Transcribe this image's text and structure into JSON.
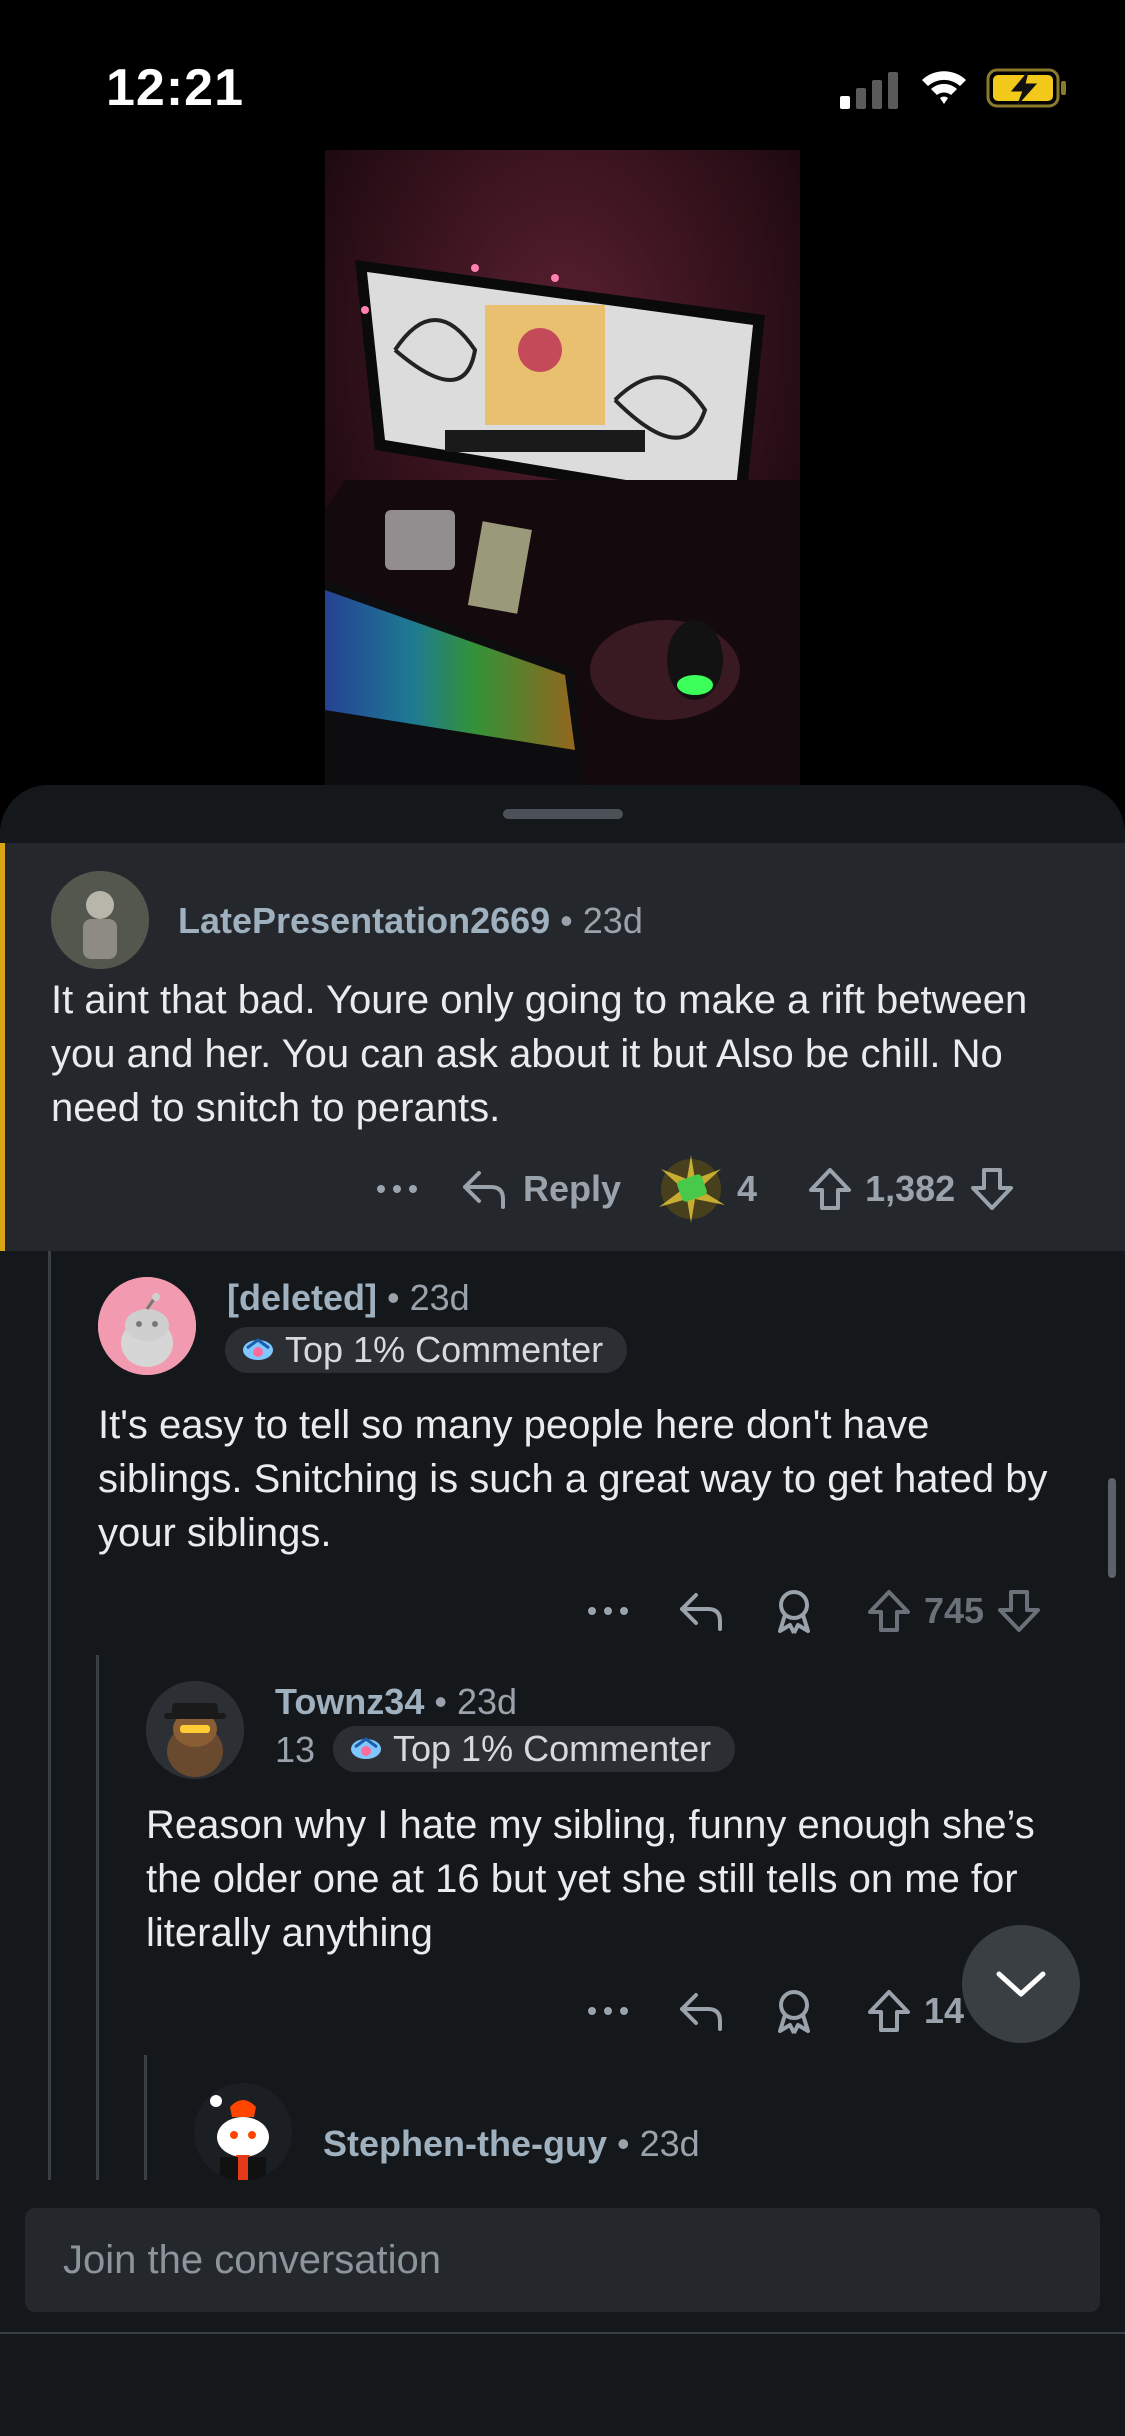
{
  "status_bar": {
    "time": "12:21",
    "icons": [
      "cellular-signal-icon",
      "wifi-icon",
      "battery-charging-icon"
    ]
  },
  "media": {
    "icon": "photo-of-monitor-and-keyboard"
  },
  "comments": [
    {
      "username": "LatePresentation2669",
      "age": "23d",
      "body": "It aint that bad. Youre only going to make a rift between you and her. You can ask about it but Also be chill. No need to snitch to perants.",
      "reply_label": "Reply",
      "award_count": "4",
      "score": "1,382"
    },
    {
      "username": "[deleted]",
      "age": "23d",
      "flair": "Top 1% Commenter",
      "body": "It's easy to tell so many people here don't have siblings. Snitching is such a great way to get hated by your siblings.",
      "score": "745"
    },
    {
      "username": "Townz34",
      "age": "23d",
      "karma_prefix": "13",
      "flair": "Top 1% Commenter",
      "body": "Reason why I hate my sibling, funny enough she’s the older one at 16 but yet she still tells on me for literally anything",
      "score": "14"
    },
    {
      "username": "Stephen-the-guy",
      "age": "23d"
    }
  ],
  "composer": {
    "placeholder": "Join the conversation"
  },
  "colors": {
    "highlight_border": "#d9a514",
    "sheet_bg": "#15181b",
    "highlight_bg": "#24272b"
  }
}
